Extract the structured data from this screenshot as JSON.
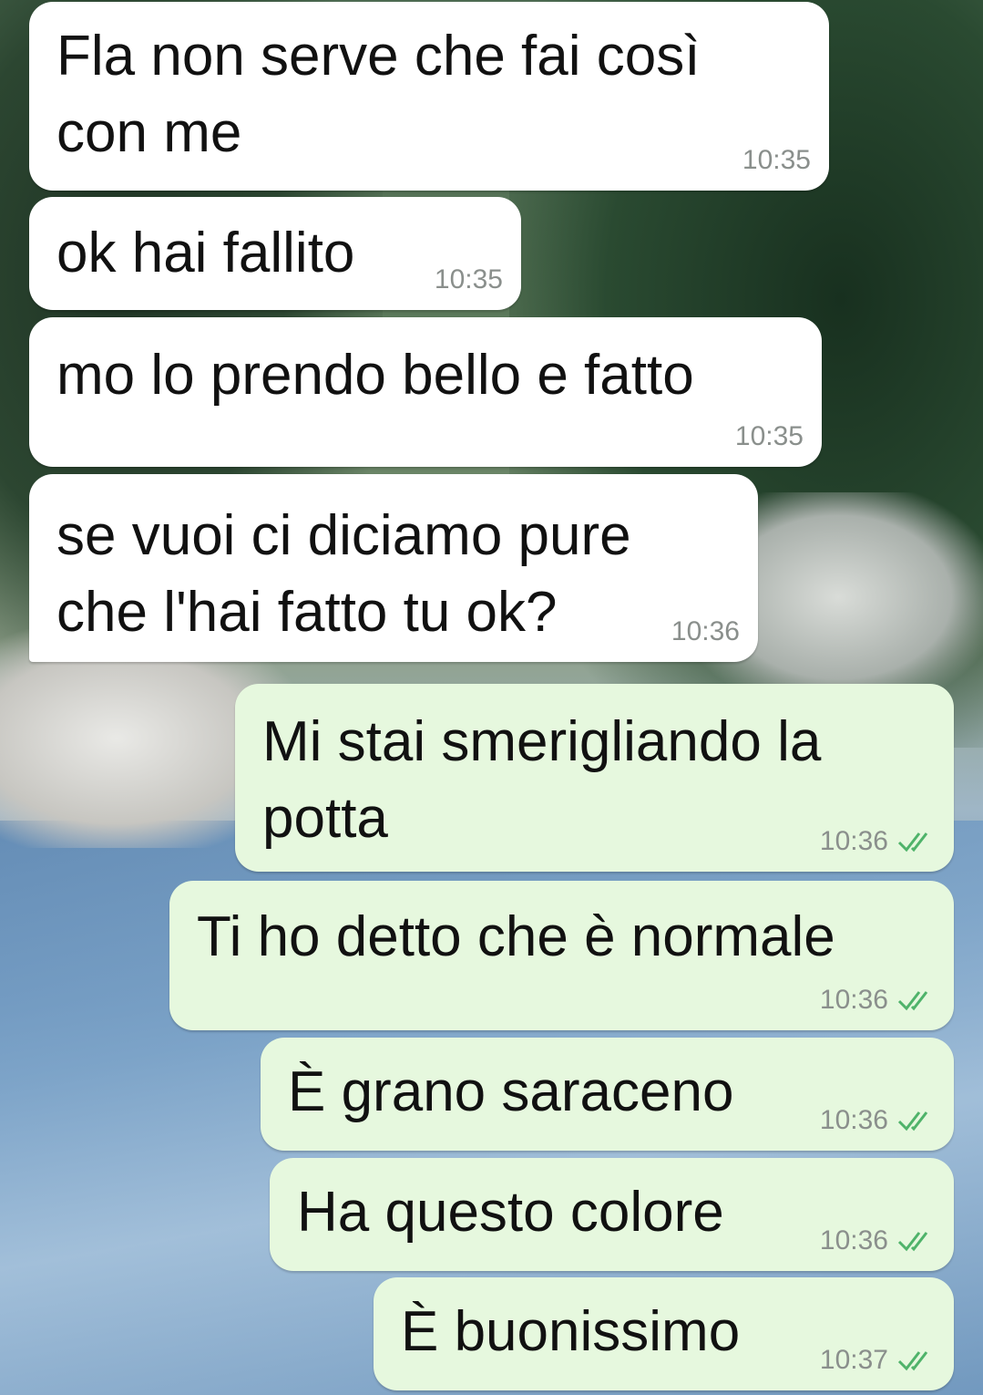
{
  "messages": [
    {
      "direction": "incoming",
      "text_lines": [
        "Fla non serve che fai così",
        "con me"
      ],
      "time": "10:35"
    },
    {
      "direction": "incoming",
      "text_lines": [
        "ok hai fallito"
      ],
      "time": "10:35"
    },
    {
      "direction": "incoming",
      "text_lines": [
        "mo lo prendo bello e fatto"
      ],
      "time": "10:35"
    },
    {
      "direction": "incoming",
      "text_lines": [
        "se vuoi ci diciamo pure",
        "che l'hai fatto tu ok?"
      ],
      "time": "10:36"
    },
    {
      "direction": "outgoing",
      "text_lines": [
        "Mi stai smerigliando la",
        "potta"
      ],
      "time": "10:36",
      "status": "read"
    },
    {
      "direction": "outgoing",
      "text_lines": [
        "Ti ho detto che è normale"
      ],
      "time": "10:36",
      "status": "read"
    },
    {
      "direction": "outgoing",
      "text_lines": [
        "È grano saraceno"
      ],
      "time": "10:36",
      "status": "read"
    },
    {
      "direction": "outgoing",
      "text_lines": [
        "Ha questo colore"
      ],
      "time": "10:36",
      "status": "read"
    },
    {
      "direction": "outgoing",
      "text_lines": [
        "È buonissimo"
      ],
      "time": "10:37",
      "status": "read"
    }
  ],
  "icons": {
    "read_receipt": "double-check-icon"
  },
  "colors": {
    "incoming_bubble": "#ffffff",
    "outgoing_bubble": "#e6f8de",
    "read_ticks": "#4fb36a",
    "timestamp": "#8a8f8c"
  }
}
